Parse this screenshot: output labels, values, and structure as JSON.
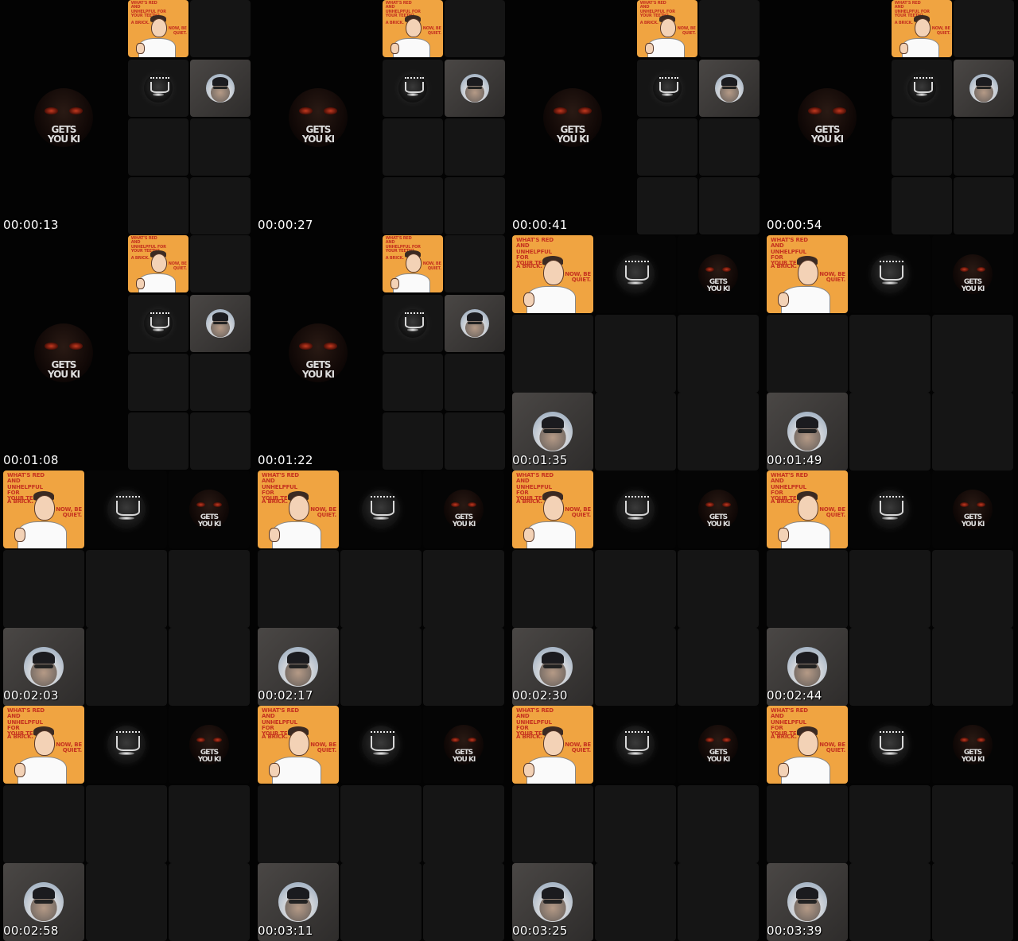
{
  "contact_sheet": {
    "frames": [
      {
        "timestamp": "00:00:13",
        "layout": "A"
      },
      {
        "timestamp": "00:00:27",
        "layout": "A"
      },
      {
        "timestamp": "00:00:41",
        "layout": "A"
      },
      {
        "timestamp": "00:00:54",
        "layout": "A"
      },
      {
        "timestamp": "00:01:08",
        "layout": "A"
      },
      {
        "timestamp": "00:01:22",
        "layout": "A"
      },
      {
        "timestamp": "00:01:35",
        "layout": "B"
      },
      {
        "timestamp": "00:01:49",
        "layout": "B"
      },
      {
        "timestamp": "00:02:03",
        "layout": "B"
      },
      {
        "timestamp": "00:02:17",
        "layout": "B"
      },
      {
        "timestamp": "00:02:30",
        "layout": "B"
      },
      {
        "timestamp": "00:02:44",
        "layout": "B"
      },
      {
        "timestamp": "00:02:58",
        "layout": "B"
      },
      {
        "timestamp": "00:03:11",
        "layout": "B"
      },
      {
        "timestamp": "00:03:25",
        "layout": "B"
      },
      {
        "timestamp": "00:03:39",
        "layout": "B"
      }
    ]
  },
  "card": {
    "line1": "WHAT'S RED AND",
    "line2": "UNHELPFUL FOR",
    "line3": "YOUR TEETH?",
    "line4": "A BRICK.",
    "line5": "NOW, BE",
    "line6": "QUIET."
  },
  "mask_text": "GETS YOU KI",
  "colors": {
    "background": "#000000",
    "tile": "#151515",
    "card_orange": "#f0a441",
    "card_text": "#c5321f",
    "timestamp": "#ffffff"
  },
  "icons": [
    "cartoon-man-card",
    "crown-orb-avatar",
    "demon-mask-avatar",
    "person-cap-avatar"
  ]
}
